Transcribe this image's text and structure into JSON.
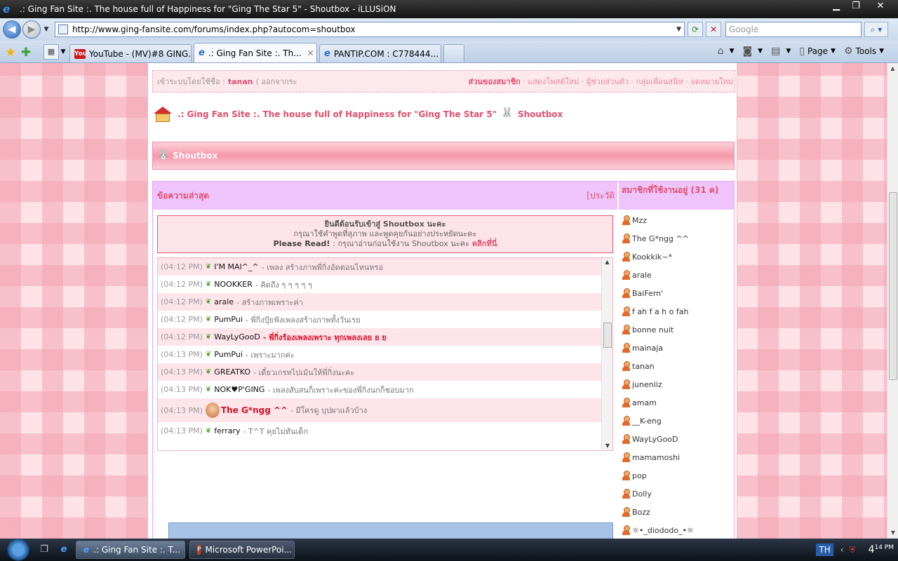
{
  "window": {
    "title": ".: Ging Fan Site :. The house full of Happiness for \"Ging The Star 5\" - Shoutbox - iLLUSiON",
    "buttons": [
      "▁",
      "❐",
      "✕"
    ]
  },
  "address": {
    "url": "http://www.ging-fansite.com/forums/index.php?autocom=shoutbox",
    "search_placeholder": "Google"
  },
  "tabs": [
    {
      "label": "YouTube - (MV)#8 GING...",
      "icon": "youtube-icon",
      "active": false
    },
    {
      "label": ".: Ging Fan Site :. Th...",
      "icon": "ie-icon",
      "active": true
    },
    {
      "label": "PANTIP.COM : C778444...",
      "icon": "ie-icon",
      "active": false
    }
  ],
  "commandbar": {
    "page_label": "Page",
    "tools_label": "Tools"
  },
  "forum": {
    "login": {
      "prefix": "เข้าระบบโดยใช้ชื่อ :",
      "username": "tanan",
      "logout": "( ออกจากระ",
      "member_area": "ส่วนของสมาชิก",
      "links": "· แสดงโพสต์ใหม่ · ผู้ช่วยส่วนตัว · กลุ่มเพื่อนสนิท · จดหมายใหม่"
    },
    "breadcrumb": {
      "site": ".: Ging Fan Site :. The house full of Happiness for \"Ging The Star 5\"",
      "page": "Shoutbox"
    },
    "shoutbox_title": "Shoutbox",
    "latest_header": "ข้อความล่าสุด",
    "history_link": "[ประวัติ",
    "members_header": "สมาชิกที่ใช้งานอยู่ (31 ค)",
    "welcome": {
      "line1": "ยินดีต้อนรับเข้าสู่ Shoutbox นะคะ",
      "line2": "กรุณาใช้คำพูดที่สุภาพ และพูดคุยกันอย่างประหยัดนะคะ",
      "line3_bold": "Please Read!",
      "line3_text": ": กรุณาอ่านก่อนใช้งาน Shoutbox นะคะ",
      "line3_link": "คลิกที่นี่"
    },
    "shouts": [
      {
        "time": "(04:12 PM)",
        "user": "I'M MAI^_^",
        "msg": "- เพลง สร้างภาพพี่กิ่งอัดตอนไหนหรอ"
      },
      {
        "time": "(04:12 PM)",
        "user": "NOOKKER",
        "msg": "- คิดถึง ๆ ๆ ๆ ๆ ๆ"
      },
      {
        "time": "(04:12 PM)",
        "user": "arale",
        "msg": "- สร้างภาพเพราะค่า"
      },
      {
        "time": "(04:12 PM)",
        "user": "PumPui",
        "msg": "- พี่กิ่งปุ้ยฟังเพลงสร้างภาพทั้งวันเรย"
      },
      {
        "time": "(04:12 PM)",
        "user": "WayLyGooD",
        "msg": "- พี่กิ่งร้องเพลงเพราะ ทุกเพลงเลย ย ย"
      },
      {
        "time": "(04:13 PM)",
        "user": "PumPui",
        "msg": "- เพราะมากค่ะ"
      },
      {
        "time": "(04:13 PM)",
        "user": "GREATKO",
        "msg": "- เดี๋ยวเกรทไปเม้นให้พี่กิ่งนะคะ"
      },
      {
        "time": "(04:13 PM)",
        "user": "NOK♥P'GING",
        "msg": "- เพลงสับสนก็เพราะค่ะของพี่กิ่งนกก็ชอบมาก"
      },
      {
        "time": "(04:13 PM)",
        "user": "The G*ngg ^^",
        "msg": "- มีใครดู บุปผาแล้วบ้าง"
      },
      {
        "time": "(04:13 PM)",
        "user": "ferrary",
        "msg": "- T^T คุยไม่ทันเด็ก"
      }
    ],
    "members": [
      "Mzz",
      "The G*ngg ^^",
      "Kookkik~*",
      "arale",
      "BaiFern'",
      "f ah f a h o fah",
      "bonne nuit",
      "mainaja",
      "tanan",
      "juneniiz",
      "amam",
      "__K-eng",
      "WayLyGooD",
      "mamamoshi",
      "pop",
      "Dolly",
      "Bozz",
      "☼•_diododo_•☼"
    ]
  },
  "taskbar": {
    "items": [
      {
        "label": ".: Ging Fan Site :. T...",
        "icon": "ie-icon"
      },
      {
        "label": "Microsoft PowerPoi...",
        "icon": "powerpoint-icon"
      }
    ],
    "lang": "TH",
    "time": "4",
    "time_suffix": "14 PM"
  },
  "colors": {
    "accent": "#e14f6d",
    "header_lilac": "#efc4fb",
    "background_pink": "#fde3e8"
  }
}
